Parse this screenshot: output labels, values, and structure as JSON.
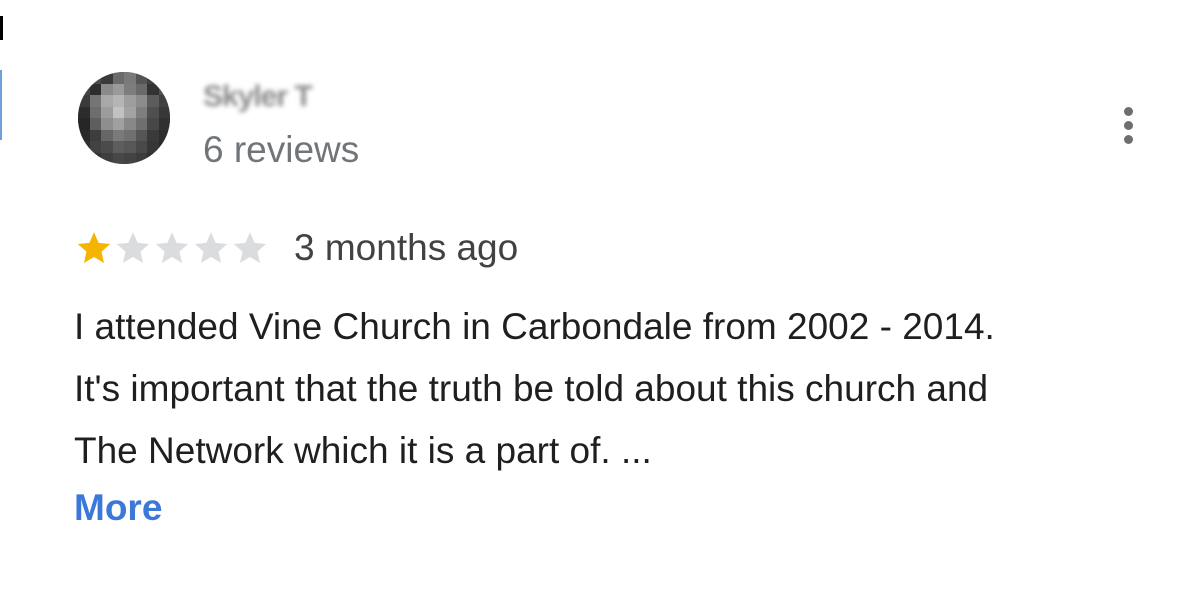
{
  "review": {
    "author": {
      "name": "Skyler T",
      "review_count": "6 reviews",
      "avatar_icon": "blurred-profile-photo"
    },
    "menu_icon": "more-vert-icon",
    "rating": {
      "value": 1,
      "max": 5,
      "filled_color": "#f4b400",
      "empty_color": "#dadce0"
    },
    "time_ago": "3 months ago",
    "text_lines": [
      "I attended Vine Church in Carbondale from 2002 - 2014.",
      "It's important that the truth be told about this church and",
      "The Network which it is a part of. ..."
    ],
    "more_label": "More",
    "link_color": "#3c78d8"
  }
}
